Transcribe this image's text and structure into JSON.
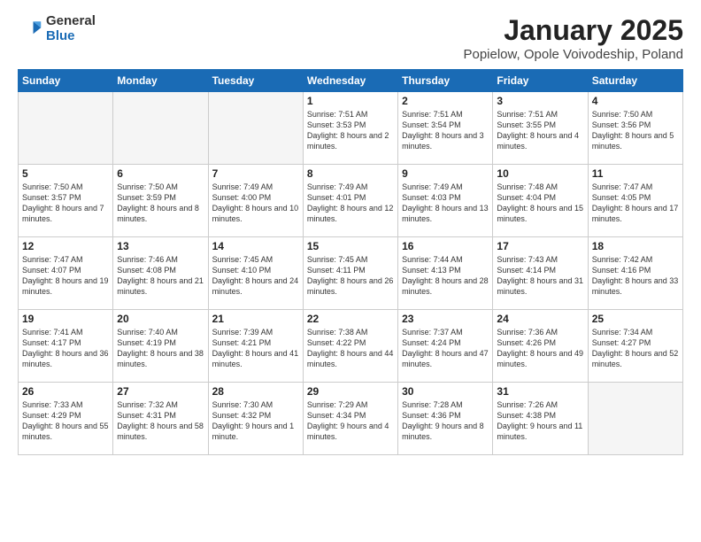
{
  "logo": {
    "general": "General",
    "blue": "Blue"
  },
  "title": "January 2025",
  "subtitle": "Popielow, Opole Voivodeship, Poland",
  "weekdays": [
    "Sunday",
    "Monday",
    "Tuesday",
    "Wednesday",
    "Thursday",
    "Friday",
    "Saturday"
  ],
  "weeks": [
    [
      {
        "day": "",
        "info": ""
      },
      {
        "day": "",
        "info": ""
      },
      {
        "day": "",
        "info": ""
      },
      {
        "day": "1",
        "info": "Sunrise: 7:51 AM\nSunset: 3:53 PM\nDaylight: 8 hours and 2 minutes."
      },
      {
        "day": "2",
        "info": "Sunrise: 7:51 AM\nSunset: 3:54 PM\nDaylight: 8 hours and 3 minutes."
      },
      {
        "day": "3",
        "info": "Sunrise: 7:51 AM\nSunset: 3:55 PM\nDaylight: 8 hours and 4 minutes."
      },
      {
        "day": "4",
        "info": "Sunrise: 7:50 AM\nSunset: 3:56 PM\nDaylight: 8 hours and 5 minutes."
      }
    ],
    [
      {
        "day": "5",
        "info": "Sunrise: 7:50 AM\nSunset: 3:57 PM\nDaylight: 8 hours and 7 minutes."
      },
      {
        "day": "6",
        "info": "Sunrise: 7:50 AM\nSunset: 3:59 PM\nDaylight: 8 hours and 8 minutes."
      },
      {
        "day": "7",
        "info": "Sunrise: 7:49 AM\nSunset: 4:00 PM\nDaylight: 8 hours and 10 minutes."
      },
      {
        "day": "8",
        "info": "Sunrise: 7:49 AM\nSunset: 4:01 PM\nDaylight: 8 hours and 12 minutes."
      },
      {
        "day": "9",
        "info": "Sunrise: 7:49 AM\nSunset: 4:03 PM\nDaylight: 8 hours and 13 minutes."
      },
      {
        "day": "10",
        "info": "Sunrise: 7:48 AM\nSunset: 4:04 PM\nDaylight: 8 hours and 15 minutes."
      },
      {
        "day": "11",
        "info": "Sunrise: 7:47 AM\nSunset: 4:05 PM\nDaylight: 8 hours and 17 minutes."
      }
    ],
    [
      {
        "day": "12",
        "info": "Sunrise: 7:47 AM\nSunset: 4:07 PM\nDaylight: 8 hours and 19 minutes."
      },
      {
        "day": "13",
        "info": "Sunrise: 7:46 AM\nSunset: 4:08 PM\nDaylight: 8 hours and 21 minutes."
      },
      {
        "day": "14",
        "info": "Sunrise: 7:45 AM\nSunset: 4:10 PM\nDaylight: 8 hours and 24 minutes."
      },
      {
        "day": "15",
        "info": "Sunrise: 7:45 AM\nSunset: 4:11 PM\nDaylight: 8 hours and 26 minutes."
      },
      {
        "day": "16",
        "info": "Sunrise: 7:44 AM\nSunset: 4:13 PM\nDaylight: 8 hours and 28 minutes."
      },
      {
        "day": "17",
        "info": "Sunrise: 7:43 AM\nSunset: 4:14 PM\nDaylight: 8 hours and 31 minutes."
      },
      {
        "day": "18",
        "info": "Sunrise: 7:42 AM\nSunset: 4:16 PM\nDaylight: 8 hours and 33 minutes."
      }
    ],
    [
      {
        "day": "19",
        "info": "Sunrise: 7:41 AM\nSunset: 4:17 PM\nDaylight: 8 hours and 36 minutes."
      },
      {
        "day": "20",
        "info": "Sunrise: 7:40 AM\nSunset: 4:19 PM\nDaylight: 8 hours and 38 minutes."
      },
      {
        "day": "21",
        "info": "Sunrise: 7:39 AM\nSunset: 4:21 PM\nDaylight: 8 hours and 41 minutes."
      },
      {
        "day": "22",
        "info": "Sunrise: 7:38 AM\nSunset: 4:22 PM\nDaylight: 8 hours and 44 minutes."
      },
      {
        "day": "23",
        "info": "Sunrise: 7:37 AM\nSunset: 4:24 PM\nDaylight: 8 hours and 47 minutes."
      },
      {
        "day": "24",
        "info": "Sunrise: 7:36 AM\nSunset: 4:26 PM\nDaylight: 8 hours and 49 minutes."
      },
      {
        "day": "25",
        "info": "Sunrise: 7:34 AM\nSunset: 4:27 PM\nDaylight: 8 hours and 52 minutes."
      }
    ],
    [
      {
        "day": "26",
        "info": "Sunrise: 7:33 AM\nSunset: 4:29 PM\nDaylight: 8 hours and 55 minutes."
      },
      {
        "day": "27",
        "info": "Sunrise: 7:32 AM\nSunset: 4:31 PM\nDaylight: 8 hours and 58 minutes."
      },
      {
        "day": "28",
        "info": "Sunrise: 7:30 AM\nSunset: 4:32 PM\nDaylight: 9 hours and 1 minute."
      },
      {
        "day": "29",
        "info": "Sunrise: 7:29 AM\nSunset: 4:34 PM\nDaylight: 9 hours and 4 minutes."
      },
      {
        "day": "30",
        "info": "Sunrise: 7:28 AM\nSunset: 4:36 PM\nDaylight: 9 hours and 8 minutes."
      },
      {
        "day": "31",
        "info": "Sunrise: 7:26 AM\nSunset: 4:38 PM\nDaylight: 9 hours and 11 minutes."
      },
      {
        "day": "",
        "info": ""
      }
    ]
  ]
}
